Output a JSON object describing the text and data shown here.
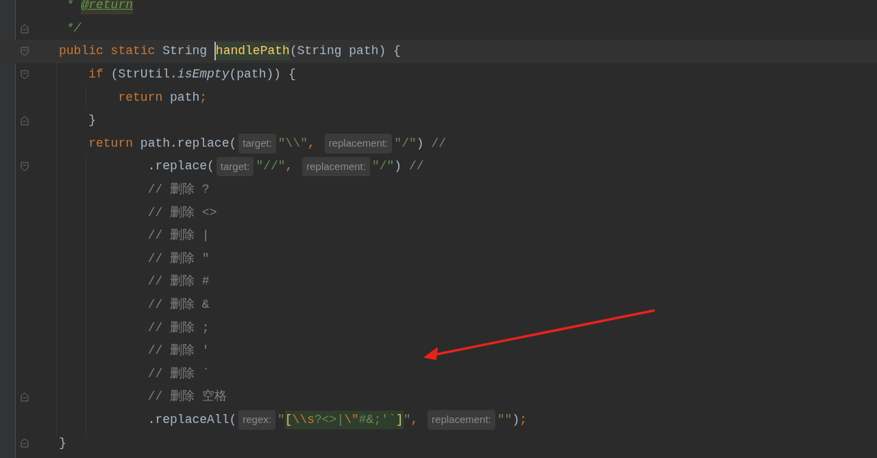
{
  "editor": {
    "lines": [
      {
        "fold_start": false,
        "fold_end": false,
        "current": false,
        "tokens": [
          {
            "kind": "doc",
            "text": " * "
          },
          {
            "kind": "doc-tag",
            "text": "@return"
          }
        ]
      },
      {
        "fold_start": false,
        "fold_end": true,
        "current": false,
        "tokens": [
          {
            "kind": "doc",
            "text": " */"
          }
        ]
      },
      {
        "fold_start": true,
        "fold_end": false,
        "current": true,
        "tokens": [
          {
            "kind": "keyword",
            "text": "public static "
          },
          {
            "kind": "plain",
            "text": "String "
          },
          {
            "kind": "declaration",
            "text": "handlePath",
            "caret": true,
            "highlight": true
          },
          {
            "kind": "plain",
            "text": "(String path) {"
          }
        ]
      },
      {
        "fold_start": true,
        "fold_end": false,
        "current": false,
        "tokens": [
          {
            "kind": "keyword",
            "text": "    if "
          },
          {
            "kind": "plain",
            "text": "(StrUtil."
          },
          {
            "kind": "italic",
            "text": "isEmpty"
          },
          {
            "kind": "plain",
            "text": "(path)) {"
          }
        ]
      },
      {
        "fold_start": false,
        "fold_end": false,
        "current": false,
        "tokens": [
          {
            "kind": "keyword",
            "text": "        return "
          },
          {
            "kind": "plain",
            "text": "path"
          },
          {
            "kind": "keyword",
            "text": ";"
          }
        ]
      },
      {
        "fold_start": false,
        "fold_end": true,
        "current": false,
        "tokens": [
          {
            "kind": "plain",
            "text": "    }"
          }
        ]
      },
      {
        "fold_start": false,
        "fold_end": false,
        "current": false,
        "tokens": [
          {
            "kind": "keyword",
            "text": "    return "
          },
          {
            "kind": "plain",
            "text": "path.replace("
          },
          {
            "kind": "hint",
            "text": "target:"
          },
          {
            "kind": "string",
            "text": "\"\\\\\""
          },
          {
            "kind": "keyword",
            "text": ", "
          },
          {
            "kind": "hint",
            "text": "replacement:"
          },
          {
            "kind": "string",
            "text": "\"/\""
          },
          {
            "kind": "plain",
            "text": ") "
          },
          {
            "kind": "comment",
            "text": "//"
          }
        ]
      },
      {
        "fold_start": true,
        "fold_end": false,
        "current": false,
        "tokens": [
          {
            "kind": "plain",
            "text": "            .replace("
          },
          {
            "kind": "hint",
            "text": "target:"
          },
          {
            "kind": "string",
            "text": "\"//\""
          },
          {
            "kind": "keyword",
            "text": ", "
          },
          {
            "kind": "hint",
            "text": "replacement:"
          },
          {
            "kind": "string",
            "text": "\"/\""
          },
          {
            "kind": "plain",
            "text": ") "
          },
          {
            "kind": "comment",
            "text": "//"
          }
        ]
      },
      {
        "fold_start": false,
        "fold_end": false,
        "current": false,
        "tokens": [
          {
            "kind": "comment",
            "text": "            // 删除 ?"
          }
        ]
      },
      {
        "fold_start": false,
        "fold_end": false,
        "current": false,
        "tokens": [
          {
            "kind": "comment",
            "text": "            // 删除 <>"
          }
        ]
      },
      {
        "fold_start": false,
        "fold_end": false,
        "current": false,
        "tokens": [
          {
            "kind": "comment",
            "text": "            // 删除 |"
          }
        ]
      },
      {
        "fold_start": false,
        "fold_end": false,
        "current": false,
        "tokens": [
          {
            "kind": "comment",
            "text": "            // 删除 \""
          }
        ]
      },
      {
        "fold_start": false,
        "fold_end": false,
        "current": false,
        "tokens": [
          {
            "kind": "comment",
            "text": "            // 删除 #"
          }
        ]
      },
      {
        "fold_start": false,
        "fold_end": false,
        "current": false,
        "tokens": [
          {
            "kind": "comment",
            "text": "            // 删除 &"
          }
        ]
      },
      {
        "fold_start": false,
        "fold_end": false,
        "current": false,
        "tokens": [
          {
            "kind": "comment",
            "text": "            // 删除 ;"
          }
        ]
      },
      {
        "fold_start": false,
        "fold_end": false,
        "current": false,
        "tokens": [
          {
            "kind": "comment",
            "text": "            // 删除 '"
          }
        ]
      },
      {
        "fold_start": false,
        "fold_end": false,
        "current": false,
        "tokens": [
          {
            "kind": "comment",
            "text": "            // 删除 `"
          }
        ]
      },
      {
        "fold_start": false,
        "fold_end": true,
        "current": false,
        "tokens": [
          {
            "kind": "comment",
            "text": "            // 删除 空格"
          }
        ]
      },
      {
        "fold_start": false,
        "fold_end": false,
        "current": false,
        "tokens": [
          {
            "kind": "plain",
            "text": "            .replaceAll("
          },
          {
            "kind": "hint",
            "text": "regex:"
          },
          {
            "kind": "string",
            "text": "\""
          },
          {
            "kind": "bracket",
            "text": "[",
            "highlight": true
          },
          {
            "kind": "escape",
            "text": "\\\\s",
            "highlight": true
          },
          {
            "kind": "string",
            "text": "?<>|",
            "highlight": true
          },
          {
            "kind": "escape",
            "text": "\\\"",
            "highlight": true
          },
          {
            "kind": "string",
            "text": "#&;'`",
            "highlight": true
          },
          {
            "kind": "bracket",
            "text": "]",
            "highlight": true
          },
          {
            "kind": "string",
            "text": "\""
          },
          {
            "kind": "keyword",
            "text": ", "
          },
          {
            "kind": "hint",
            "text": "replacement:"
          },
          {
            "kind": "string",
            "text": "\"\""
          },
          {
            "kind": "plain",
            "text": ")"
          },
          {
            "kind": "keyword",
            "text": ";"
          }
        ]
      },
      {
        "fold_start": false,
        "fold_end": true,
        "current": false,
        "tokens": [
          {
            "kind": "plain",
            "text": "}"
          }
        ]
      }
    ]
  }
}
